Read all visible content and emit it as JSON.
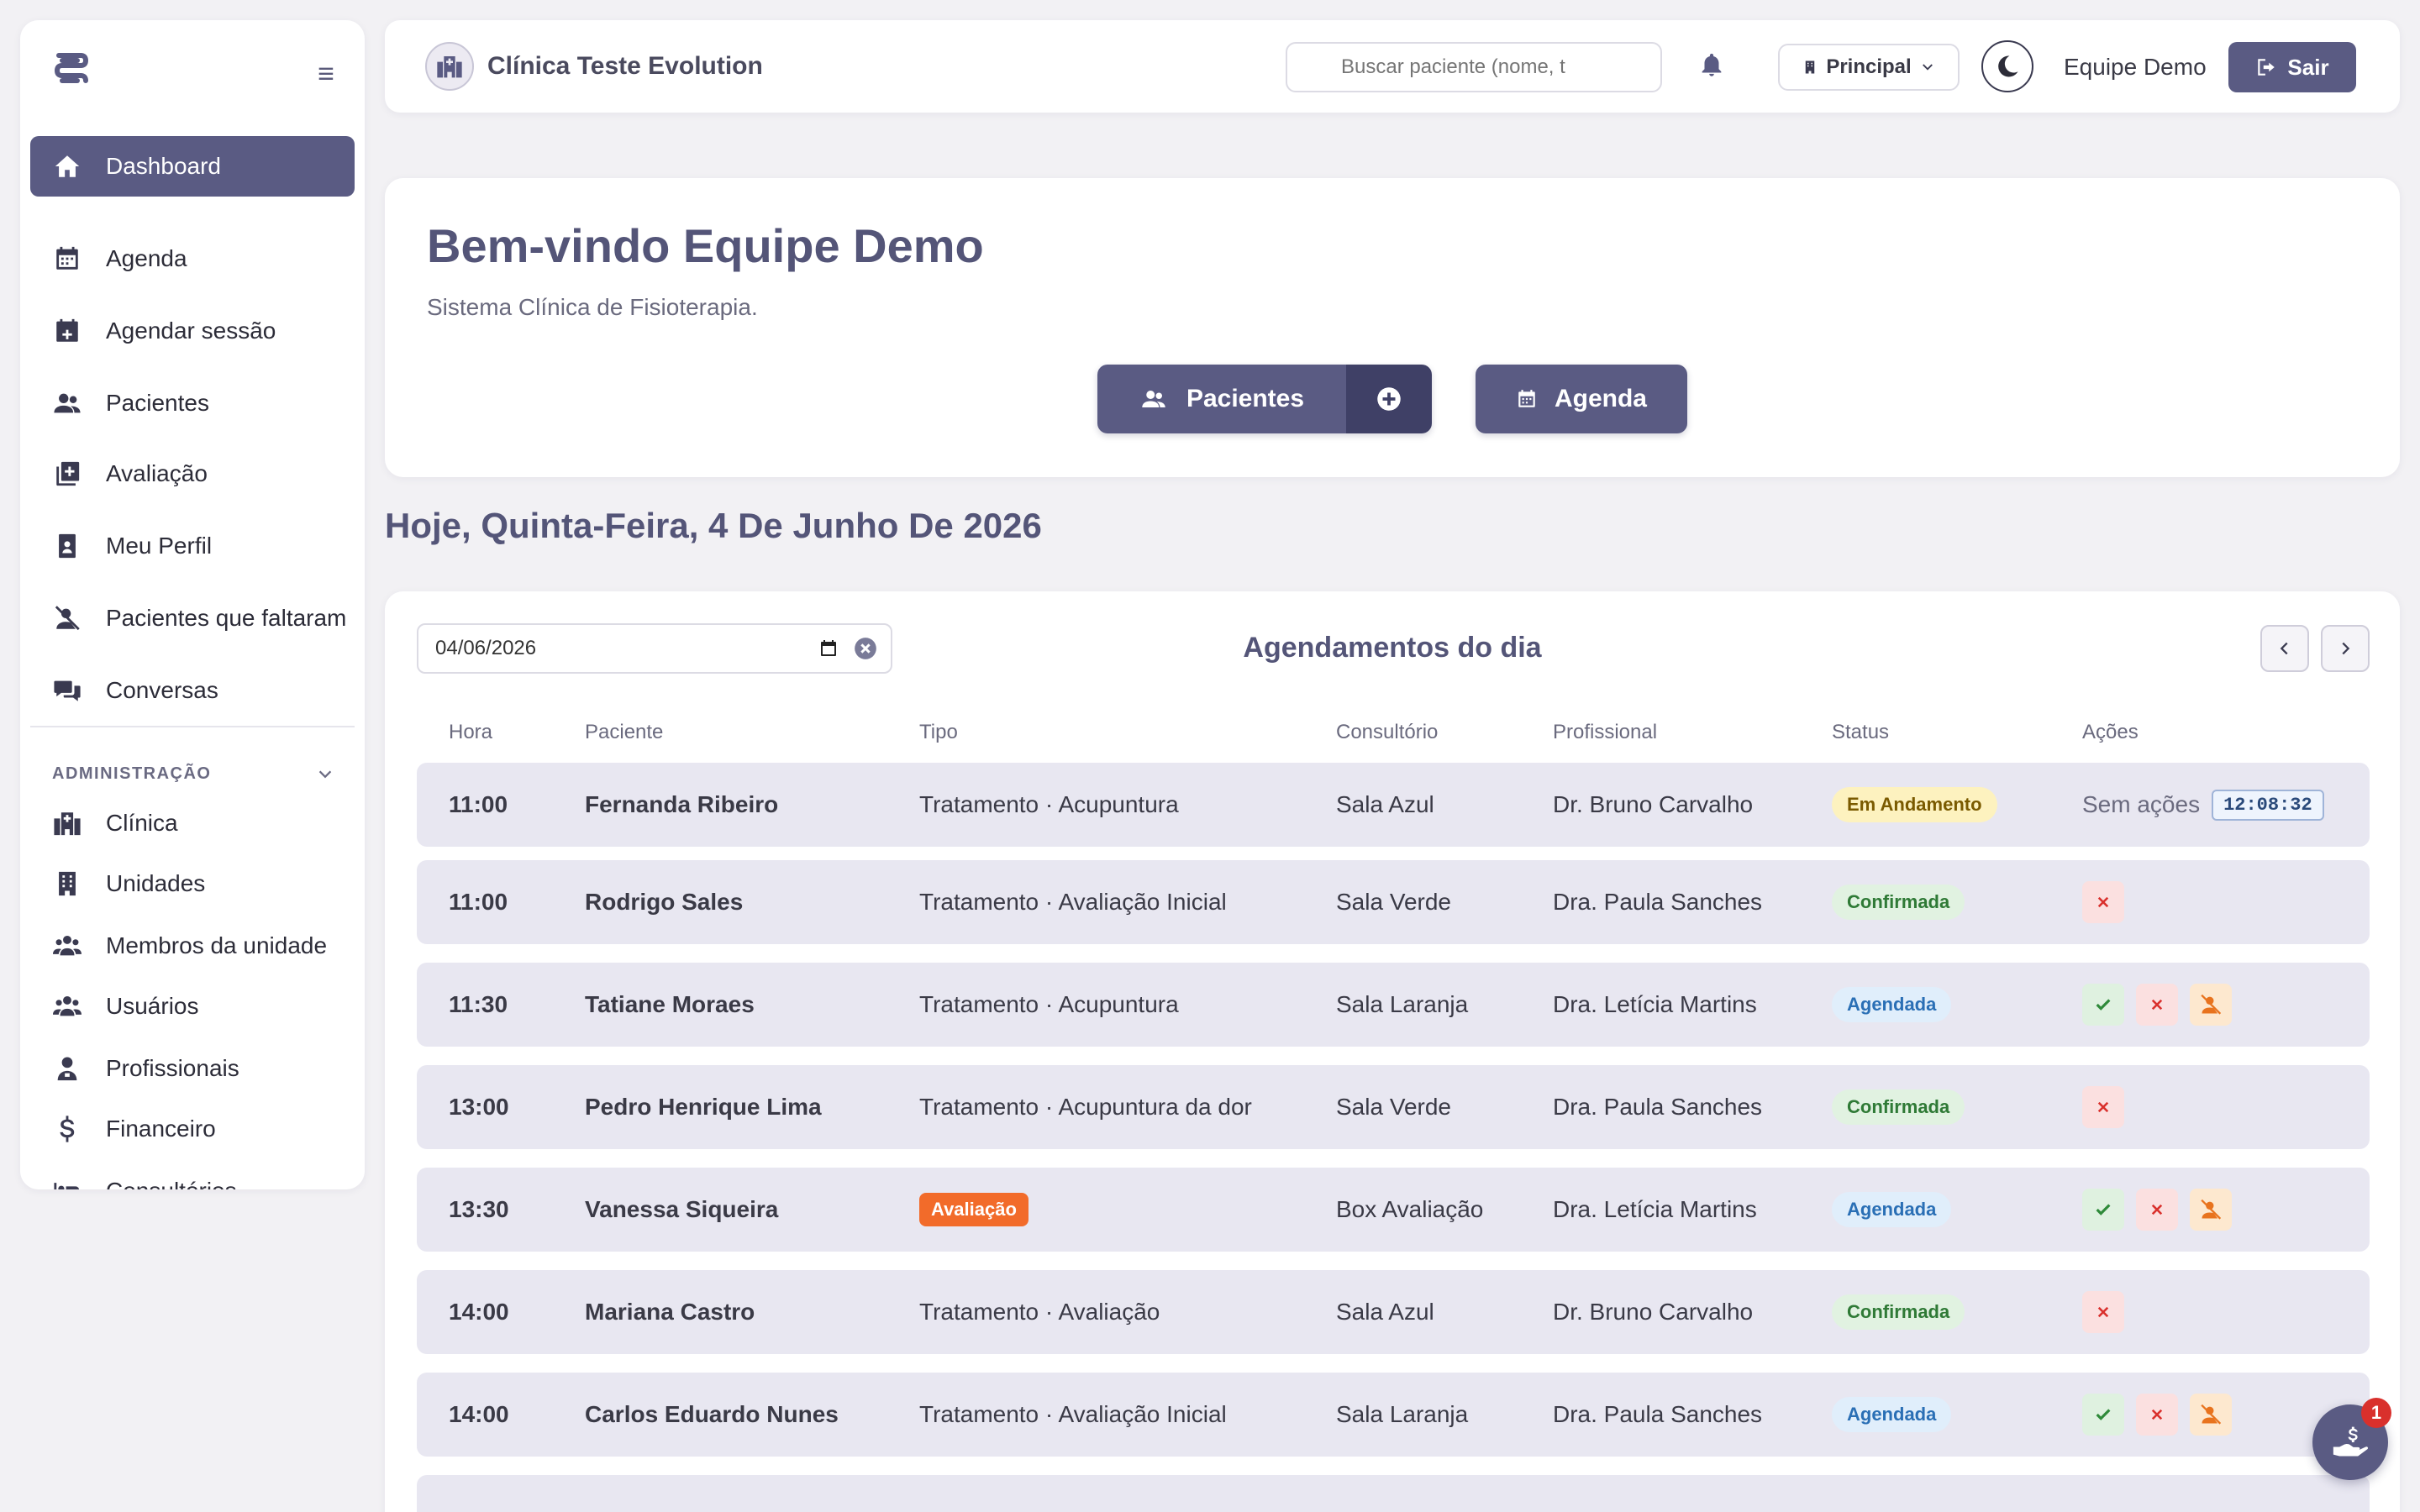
{
  "sidebar": {
    "items": [
      {
        "label": "Dashboard",
        "icon": "home-icon"
      },
      {
        "label": "Agenda",
        "icon": "calendar-icon"
      },
      {
        "label": "Agendar sessão",
        "icon": "calendar-plus-icon"
      },
      {
        "label": "Pacientes",
        "icon": "users-icon"
      },
      {
        "label": "Avaliação",
        "icon": "clipboard-plus-icon"
      },
      {
        "label": "Meu Perfil",
        "icon": "id-badge-icon"
      },
      {
        "label": "Pacientes que faltaram",
        "icon": "user-slash-icon"
      },
      {
        "label": "Conversas",
        "icon": "comments-icon"
      }
    ],
    "admin_title": "ADMINISTRAÇÃO",
    "admin_items": [
      {
        "label": "Clínica",
        "icon": "hospital-icon"
      },
      {
        "label": "Unidades",
        "icon": "building-icon"
      },
      {
        "label": "Membros da unidade",
        "icon": "users-group-icon"
      },
      {
        "label": "Usuários",
        "icon": "users-group-icon"
      },
      {
        "label": "Profissionais",
        "icon": "user-doctor-icon"
      },
      {
        "label": "Financeiro",
        "icon": "dollar-icon"
      },
      {
        "label": "Consultórios",
        "icon": "bed-icon"
      }
    ]
  },
  "topbar": {
    "clinic_name": "Clínica Teste Evolution",
    "search_placeholder": "Buscar paciente (nome, t",
    "unit": "Principal",
    "user": "Equipe Demo",
    "logout": "Sair"
  },
  "welcome": {
    "title": "Bem-vindo Equipe Demo",
    "subtitle": "Sistema Clínica de Fisioterapia.",
    "patients_button": "Pacientes",
    "agenda_button": "Agenda"
  },
  "today_heading": "Hoje, Quinta-Feira, 4 De Junho De 2026",
  "appointments": {
    "date_value": "04/06/2026",
    "title": "Agendamentos do dia",
    "columns": [
      "Hora",
      "Paciente",
      "Tipo",
      "Consultório",
      "Profissional",
      "Status",
      "Ações"
    ],
    "rows": [
      {
        "hora": "11:00",
        "paciente": "Fernanda Ribeiro",
        "tipo": "Tratamento · Acupuntura",
        "consultorio": "Sala Azul",
        "profissional": "Dr. Bruno Carvalho",
        "status": "Em Andamento",
        "acoes_text": "Sem ações",
        "timer": "12:08:32"
      },
      {
        "hora": "11:00",
        "paciente": "Rodrigo Sales",
        "tipo": "Tratamento · Avaliação Inicial",
        "consultorio": "Sala Verde",
        "profissional": "Dra. Paula Sanches",
        "status": "Confirmada"
      },
      {
        "hora": "11:30",
        "paciente": "Tatiane Moraes",
        "tipo": "Tratamento · Acupuntura",
        "consultorio": "Sala Laranja",
        "profissional": "Dra. Letícia Martins",
        "status": "Agendada"
      },
      {
        "hora": "13:00",
        "paciente": "Pedro Henrique Lima",
        "tipo": "Tratamento · Acupuntura da dor",
        "consultorio": "Sala Verde",
        "profissional": "Dra. Paula Sanches",
        "status": "Confirmada"
      },
      {
        "hora": "13:30",
        "paciente": "Vanessa Siqueira",
        "tipo_tag": "Avaliação",
        "consultorio": "Box Avaliação",
        "profissional": "Dra. Letícia Martins",
        "status": "Agendada"
      },
      {
        "hora": "14:00",
        "paciente": "Mariana Castro",
        "tipo": "Tratamento · Avaliação",
        "consultorio": "Sala Azul",
        "profissional": "Dr. Bruno Carvalho",
        "status": "Confirmada"
      },
      {
        "hora": "14:00",
        "paciente": "Carlos Eduardo Nunes",
        "tipo": "Tratamento · Avaliação Inicial",
        "consultorio": "Sala Laranja",
        "profissional": "Dra. Paula Sanches",
        "status": "Agendada"
      }
    ]
  },
  "fab": {
    "badge": "1"
  },
  "colors": {
    "primary": "#5a5b83",
    "primary_dark": "#3f4066",
    "row_bg": "#e8e7f1",
    "danger": "#d9302c",
    "warning": "#f26b2a"
  }
}
